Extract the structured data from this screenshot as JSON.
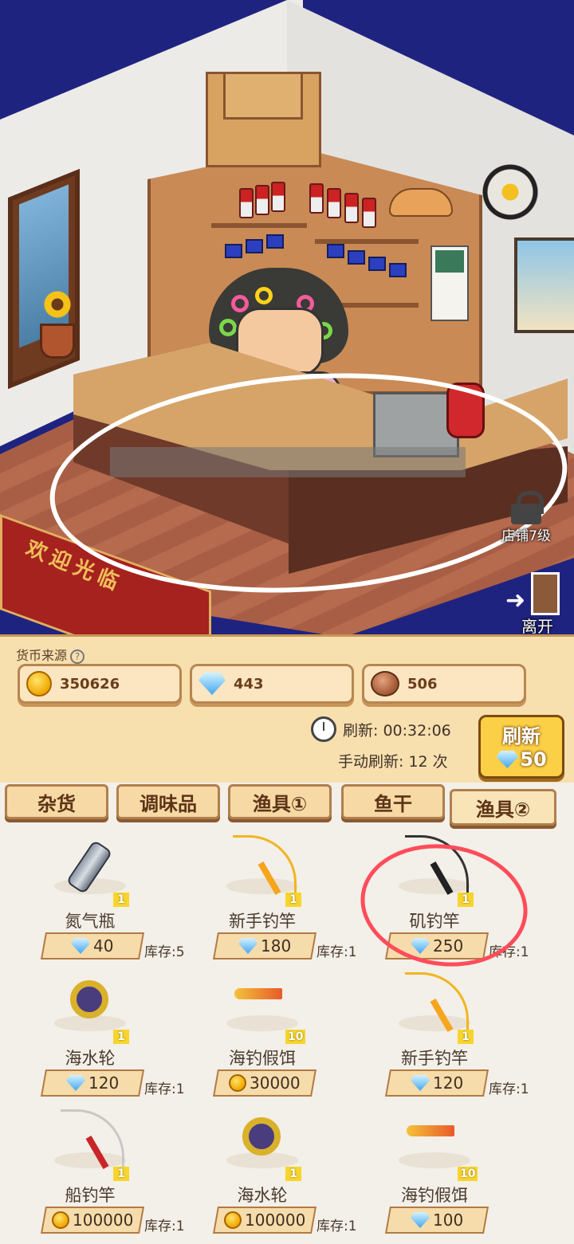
{
  "scene": {
    "mat_text": "欢迎光临",
    "lock_label": "店铺7级",
    "exit_label": "离开"
  },
  "currency": {
    "source_label": "货币来源",
    "help_icon": "question-icon",
    "gold": "350626",
    "diamond": "443",
    "copper": "506"
  },
  "refresh": {
    "timer_label": "刷新: 00:32:06",
    "manual_label": "手动刷新: 12 次",
    "button_label": "刷新",
    "button_cost": "50"
  },
  "tabs": [
    "杂货",
    "调味品",
    "渔具①",
    "鱼干",
    "渔具②"
  ],
  "active_tab": "渔具②",
  "items": [
    {
      "name": "氮气瓶",
      "qty": "1",
      "price": "40",
      "currency": "diamond",
      "stock": "库存:5",
      "icon": "gas-bottle-icon"
    },
    {
      "name": "新手钓竿",
      "qty": "1",
      "price": "180",
      "currency": "diamond",
      "stock": "库存:1",
      "icon": "beginner-rod-icon"
    },
    {
      "name": "矶钓竿",
      "qty": "1",
      "price": "250",
      "currency": "diamond",
      "stock": "库存:1",
      "icon": "rock-rod-icon"
    },
    {
      "name": "海水轮",
      "qty": "1",
      "price": "120",
      "currency": "diamond",
      "stock": "库存:1",
      "icon": "reel-icon"
    },
    {
      "name": "海钓假饵",
      "qty": "10",
      "price": "30000",
      "currency": "gold",
      "stock": "",
      "icon": "lure-icon"
    },
    {
      "name": "新手钓竿",
      "qty": "1",
      "price": "120",
      "currency": "diamond",
      "stock": "库存:1",
      "icon": "beginner-rod-icon"
    },
    {
      "name": "船钓竿",
      "qty": "1",
      "price": "100000",
      "currency": "gold",
      "stock": "库存:1",
      "icon": "boat-rod-icon"
    },
    {
      "name": "海水轮",
      "qty": "1",
      "price": "100000",
      "currency": "gold",
      "stock": "库存:1",
      "icon": "reel-icon"
    },
    {
      "name": "海钓假饵",
      "qty": "10",
      "price": "100",
      "currency": "diamond",
      "stock": "",
      "icon": "lure-icon"
    }
  ],
  "colors": {
    "panel_bg": "#f8dfae",
    "refresh_button": "#fbd046",
    "highlight_circle": "#ff4c5a"
  }
}
